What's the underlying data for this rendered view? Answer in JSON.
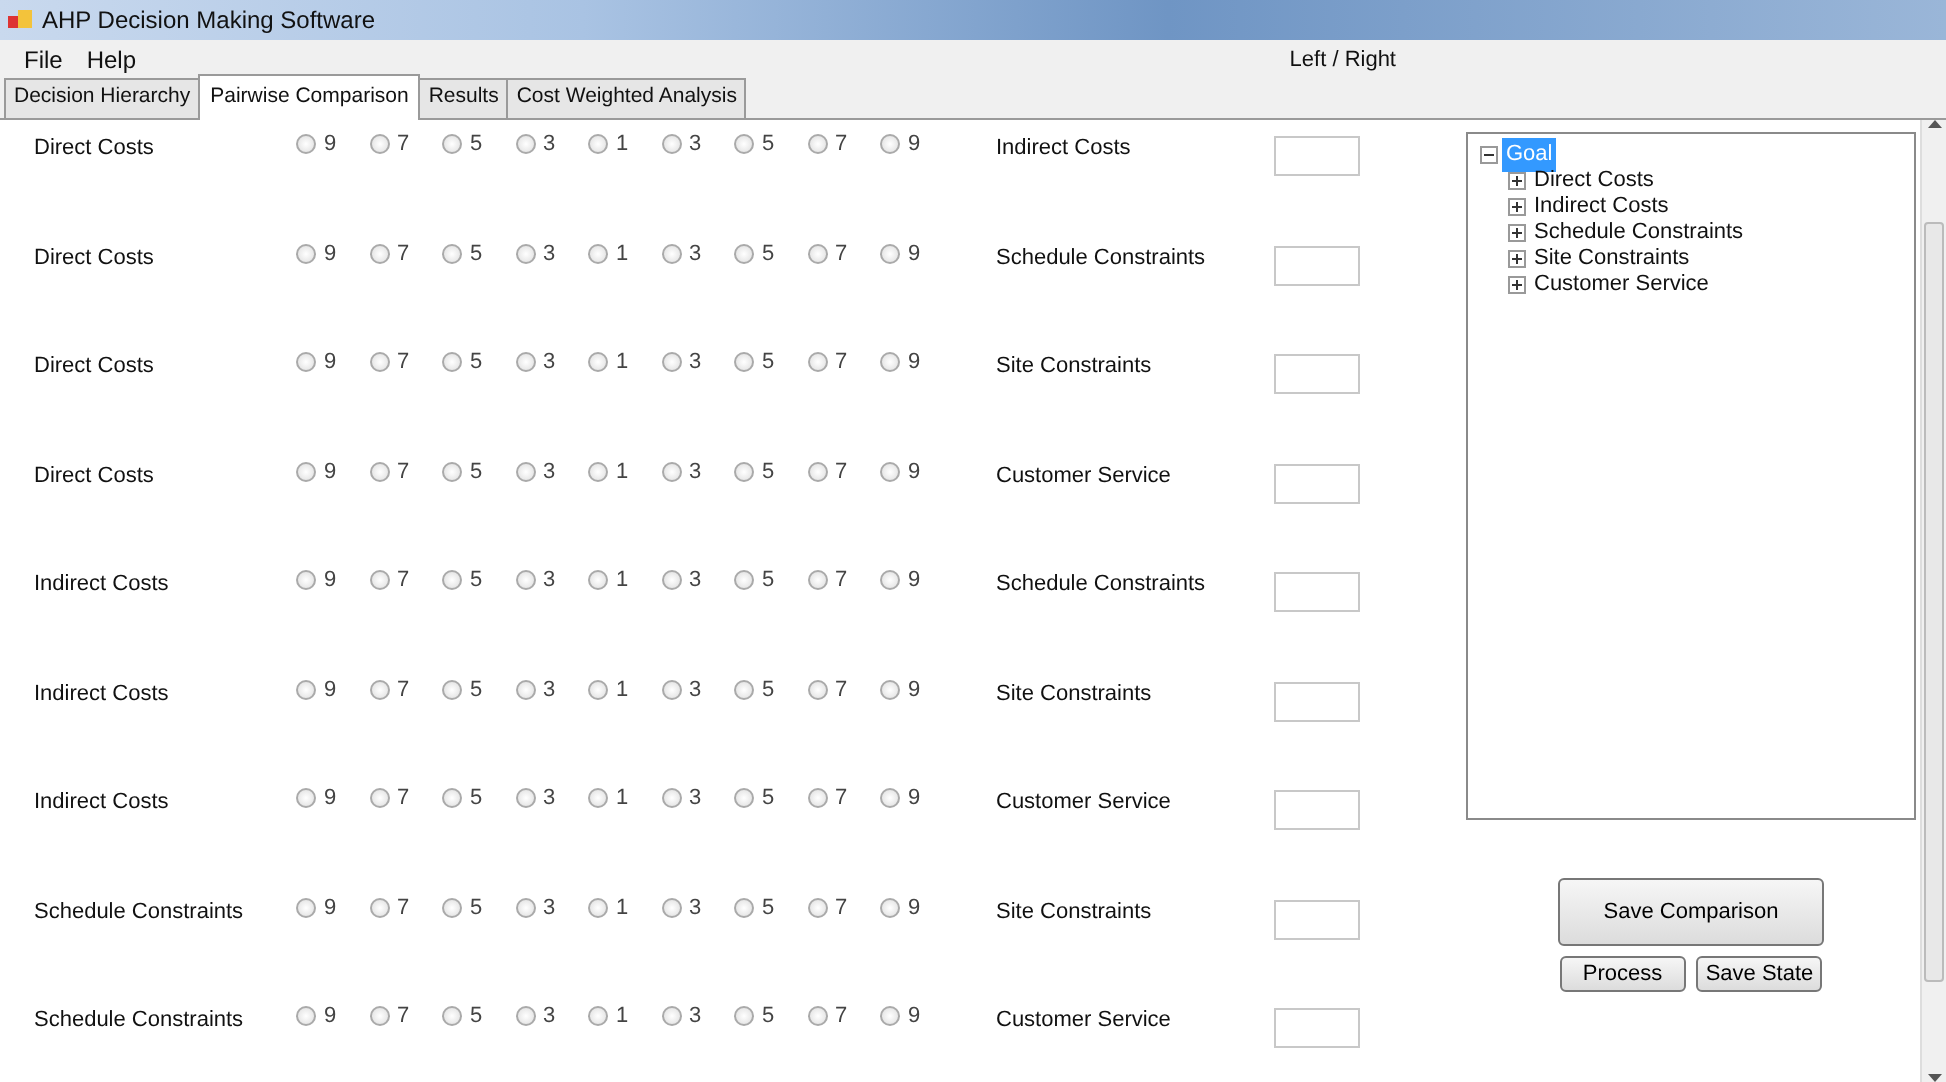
{
  "window": {
    "title": "AHP Decision Making Software"
  },
  "menu": [
    "File",
    "Help"
  ],
  "header_label": "Left / Right",
  "tabs": [
    {
      "label": "Decision Hierarchy",
      "selected": false
    },
    {
      "label": "Pairwise Comparison",
      "selected": true
    },
    {
      "label": "Results",
      "selected": false
    },
    {
      "label": "Cost Weighted Analysis",
      "selected": false
    }
  ],
  "comparisons": [
    {
      "left": "Direct Costs",
      "right": "Indirect Costs",
      "options": [
        {
          "label": "9",
          "selected": false
        },
        {
          "label": "7",
          "selected": false
        },
        {
          "label": "5",
          "selected": false
        },
        {
          "label": "3",
          "selected": false
        },
        {
          "label": "1",
          "selected": false
        },
        {
          "label": "3",
          "selected": false
        },
        {
          "label": "5",
          "selected": false
        },
        {
          "label": "7",
          "selected": false
        },
        {
          "label": "9",
          "selected": false
        }
      ]
    },
    {
      "left": "Direct Costs",
      "right": "Schedule Constraints",
      "options": [
        {
          "label": "9",
          "selected": false
        },
        {
          "label": "7",
          "selected": false
        },
        {
          "label": "5",
          "selected": false
        },
        {
          "label": "3",
          "selected": false
        },
        {
          "label": "1",
          "selected": false
        },
        {
          "label": "3",
          "selected": false
        },
        {
          "label": "5",
          "selected": false
        },
        {
          "label": "7",
          "selected": false
        },
        {
          "label": "9",
          "selected": false
        }
      ]
    },
    {
      "left": "Direct Costs",
      "right": "Site Constraints",
      "options": [
        {
          "label": "9",
          "selected": false
        },
        {
          "label": "7",
          "selected": false
        },
        {
          "label": "5",
          "selected": false
        },
        {
          "label": "3",
          "selected": false
        },
        {
          "label": "1",
          "selected": false
        },
        {
          "label": "3",
          "selected": false
        },
        {
          "label": "5",
          "selected": false
        },
        {
          "label": "7",
          "selected": false
        },
        {
          "label": "9",
          "selected": false
        }
      ]
    },
    {
      "left": "Direct Costs",
      "right": "Customer Service",
      "options": [
        {
          "label": "9",
          "selected": false
        },
        {
          "label": "7",
          "selected": false
        },
        {
          "label": "5",
          "selected": false
        },
        {
          "label": "3",
          "selected": false
        },
        {
          "label": "1",
          "selected": false
        },
        {
          "label": "3",
          "selected": false
        },
        {
          "label": "5",
          "selected": false
        },
        {
          "label": "7",
          "selected": false
        },
        {
          "label": "9",
          "selected": false
        }
      ]
    },
    {
      "left": "Indirect Costs",
      "right": "Schedule Constraints",
      "options": [
        {
          "label": "9",
          "selected": false
        },
        {
          "label": "7",
          "selected": false
        },
        {
          "label": "5",
          "selected": false
        },
        {
          "label": "3",
          "selected": false
        },
        {
          "label": "1",
          "selected": false
        },
        {
          "label": "3",
          "selected": false
        },
        {
          "label": "5",
          "selected": false
        },
        {
          "label": "7",
          "selected": false
        },
        {
          "label": "9",
          "selected": false
        }
      ]
    },
    {
      "left": "Indirect Costs",
      "right": "Site Constraints",
      "options": [
        {
          "label": "9",
          "selected": false
        },
        {
          "label": "7",
          "selected": false
        },
        {
          "label": "5",
          "selected": false
        },
        {
          "label": "3",
          "selected": false
        },
        {
          "label": "1",
          "selected": false
        },
        {
          "label": "3",
          "selected": false
        },
        {
          "label": "5",
          "selected": false
        },
        {
          "label": "7",
          "selected": false
        },
        {
          "label": "9",
          "selected": false
        }
      ]
    },
    {
      "left": "Indirect Costs",
      "right": "Customer Service",
      "options": [
        {
          "label": "9",
          "selected": false
        },
        {
          "label": "7",
          "selected": false
        },
        {
          "label": "5",
          "selected": false
        },
        {
          "label": "3",
          "selected": false
        },
        {
          "label": "1",
          "selected": false
        },
        {
          "label": "3",
          "selected": false
        },
        {
          "label": "5",
          "selected": false
        },
        {
          "label": "7",
          "selected": false
        },
        {
          "label": "9",
          "selected": false
        }
      ]
    },
    {
      "left": "Schedule Constraints",
      "right": "Site Constraints",
      "options": [
        {
          "label": "9",
          "selected": false
        },
        {
          "label": "7",
          "selected": false
        },
        {
          "label": "5",
          "selected": false
        },
        {
          "label": "3",
          "selected": false
        },
        {
          "label": "1",
          "selected": false
        },
        {
          "label": "3",
          "selected": false
        },
        {
          "label": "5",
          "selected": false
        },
        {
          "label": "7",
          "selected": false
        },
        {
          "label": "9",
          "selected": false
        }
      ]
    },
    {
      "left": "Schedule Constraints",
      "right": "Customer Service",
      "options": [
        {
          "label": "9",
          "selected": false
        },
        {
          "label": "7",
          "selected": false
        },
        {
          "label": "5",
          "selected": false
        },
        {
          "label": "3",
          "selected": false
        },
        {
          "label": "1",
          "selected": false
        },
        {
          "label": "3",
          "selected": false
        },
        {
          "label": "5",
          "selected": false
        },
        {
          "label": "7",
          "selected": false
        },
        {
          "label": "9",
          "selected": false
        }
      ]
    }
  ],
  "tree": {
    "label": "Goal",
    "selected": true,
    "expanded": true,
    "children": [
      {
        "label": "Direct Costs",
        "selected": false,
        "expanded": false
      },
      {
        "label": "Indirect Costs",
        "selected": false,
        "expanded": false
      },
      {
        "label": "Schedule Constraints",
        "selected": false,
        "expanded": false
      },
      {
        "label": "Site Constraints",
        "selected": false,
        "expanded": false
      },
      {
        "label": "Customer Service",
        "selected": false,
        "expanded": false
      }
    ]
  },
  "buttons": {
    "primary": "Save Comparison",
    "secondary": [
      "Process",
      "Save State"
    ]
  }
}
